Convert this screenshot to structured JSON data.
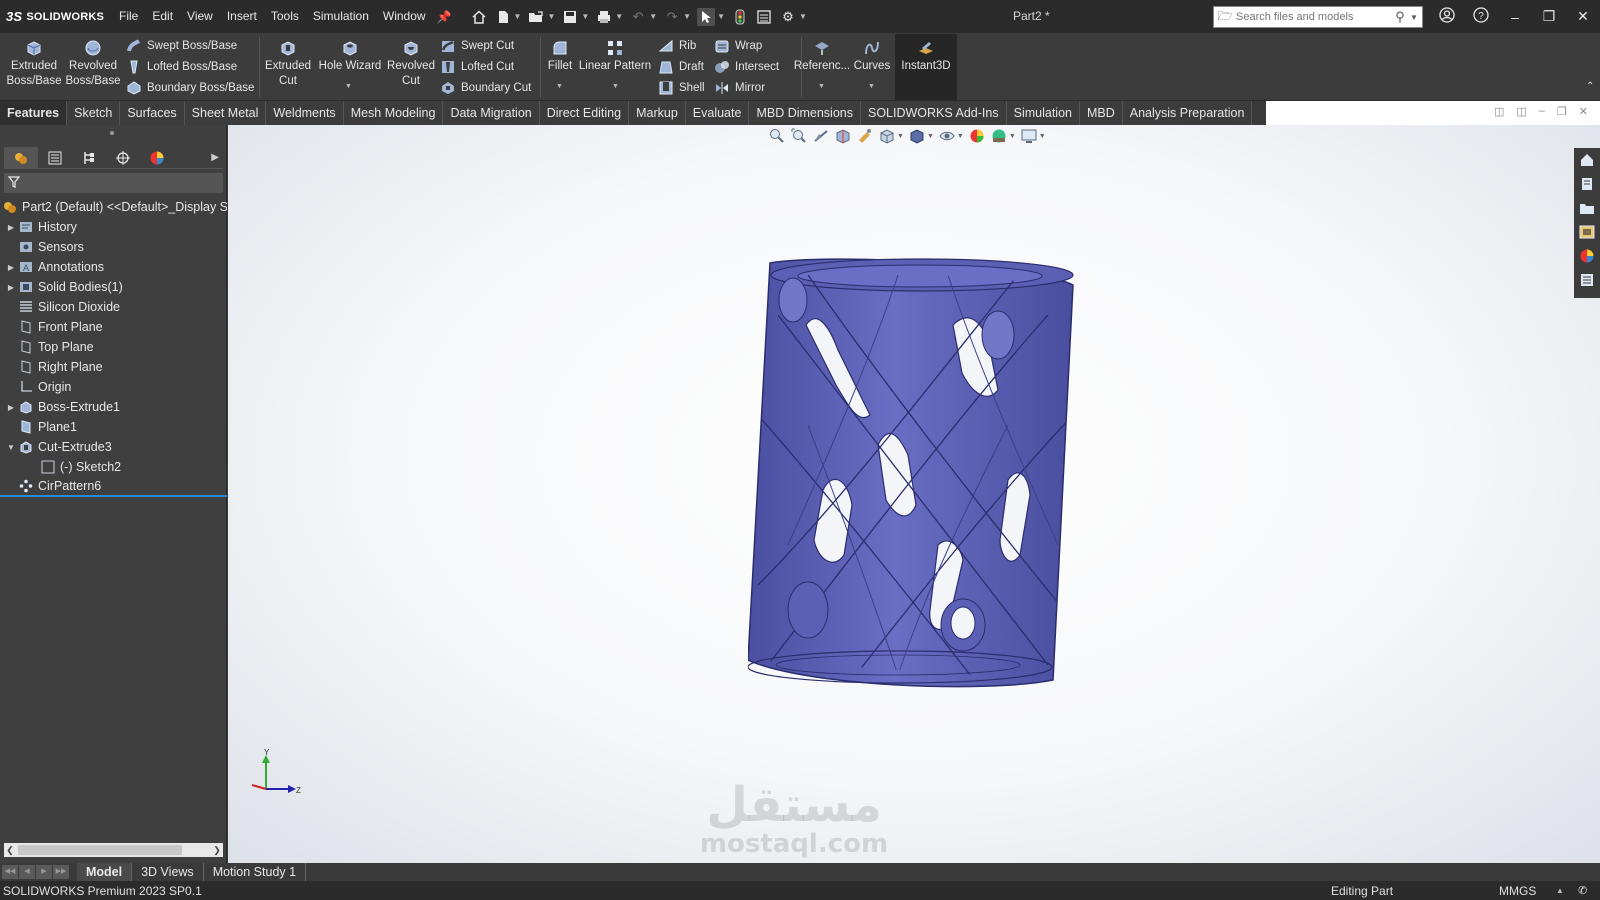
{
  "app": {
    "logo_text": "SOLIDWORKS",
    "doc_title": "Part2 *"
  },
  "menu": [
    "File",
    "Edit",
    "View",
    "Insert",
    "Tools",
    "Simulation",
    "Window"
  ],
  "search": {
    "placeholder": "Search files and models"
  },
  "ribbon": {
    "extruded_boss": "Extruded Boss/Base",
    "revolved_boss": "Revolved Boss/Base",
    "swept_boss": "Swept Boss/Base",
    "lofted_boss": "Lofted Boss/Base",
    "boundary_boss": "Boundary Boss/Base",
    "extruded_cut": "Extruded Cut",
    "hole_wizard": "Hole Wizard",
    "revolved_cut": "Revolved Cut",
    "swept_cut": "Swept Cut",
    "lofted_cut": "Lofted Cut",
    "boundary_cut": "Boundary Cut",
    "fillet": "Fillet",
    "linear_pattern": "Linear Pattern",
    "rib": "Rib",
    "draft": "Draft",
    "shell": "Shell",
    "wrap": "Wrap",
    "intersect": "Intersect",
    "mirror": "Mirror",
    "reference": "Referenc...",
    "curves": "Curves",
    "instant3d": "Instant3D"
  },
  "tabs": [
    "Features",
    "Sketch",
    "Surfaces",
    "Sheet Metal",
    "Weldments",
    "Mesh Modeling",
    "Data Migration",
    "Direct Editing",
    "Markup",
    "Evaluate",
    "MBD Dimensions",
    "SOLIDWORKS Add-Ins",
    "Simulation",
    "MBD",
    "Analysis Preparation"
  ],
  "tree": {
    "root": "Part2 (Default) <<Default>_Display S",
    "items": [
      "History",
      "Sensors",
      "Annotations",
      "Solid Bodies(1)",
      "Silicon Dioxide",
      "Front Plane",
      "Top Plane",
      "Right Plane",
      "Origin",
      "Boss-Extrude1",
      "Plane1",
      "Cut-Extrude3",
      "(-) Sketch2",
      "CirPattern6"
    ]
  },
  "triad": {
    "y": "Y",
    "z": "Z"
  },
  "watermark": {
    "arabic": "مستقل",
    "latin": "mostaql.com"
  },
  "bottom_tabs": [
    "Model",
    "3D Views",
    "Motion Study 1"
  ],
  "status": {
    "product": "SOLIDWORKS Premium 2023 SP0.1",
    "mode": "Editing Part",
    "units": "MMGS"
  },
  "colors": {
    "model_fill": "#5b5fb0",
    "model_edge": "#2a2d6e",
    "selection": "#2b8ad8"
  },
  "icons": {
    "title": [
      "home-icon",
      "new-doc-icon",
      "open-icon",
      "save-icon",
      "print-icon",
      "undo-icon",
      "redo-icon",
      "select-icon",
      "rebuild-icon",
      "file-properties-icon",
      "options-icon"
    ],
    "tree_tabs": [
      "feature-manager-icon",
      "property-manager-icon",
      "configuration-manager-icon",
      "dim-xpert-icon",
      "display-manager-icon"
    ],
    "task_pane": [
      "solidworks-resources-icon",
      "design-library-icon",
      "file-explorer-icon",
      "view-palette-icon",
      "appearances-icon",
      "custom-properties-icon"
    ]
  }
}
